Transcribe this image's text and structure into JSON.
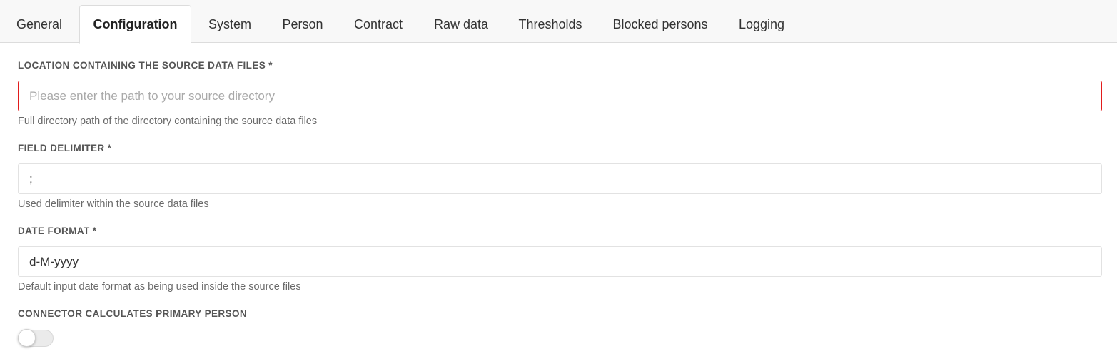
{
  "tabs": [
    {
      "label": "General",
      "active": false
    },
    {
      "label": "Configuration",
      "active": true
    },
    {
      "label": "System",
      "active": false
    },
    {
      "label": "Person",
      "active": false
    },
    {
      "label": "Contract",
      "active": false
    },
    {
      "label": "Raw data",
      "active": false
    },
    {
      "label": "Thresholds",
      "active": false
    },
    {
      "label": "Blocked persons",
      "active": false
    },
    {
      "label": "Logging",
      "active": false
    }
  ],
  "form": {
    "source_location": {
      "label": "LOCATION CONTAINING THE SOURCE DATA FILES *",
      "value": "",
      "placeholder": "Please enter the path to your source directory",
      "help": "Full directory path of the directory containing the source data files",
      "invalid": true
    },
    "field_delimiter": {
      "label": "FIELD DELIMITER *",
      "value": ";",
      "help": "Used delimiter within the source data files"
    },
    "date_format": {
      "label": "DATE FORMAT *",
      "value": "d-M-yyyy",
      "help": "Default input date format as being used inside the source files"
    },
    "primary_person": {
      "label": "CONNECTOR CALCULATES PRIMARY PERSON",
      "enabled": false
    }
  },
  "colors": {
    "invalid_border": "#e21c1c",
    "label_text": "#555555",
    "tabbar_background": "#f8f8f8"
  }
}
